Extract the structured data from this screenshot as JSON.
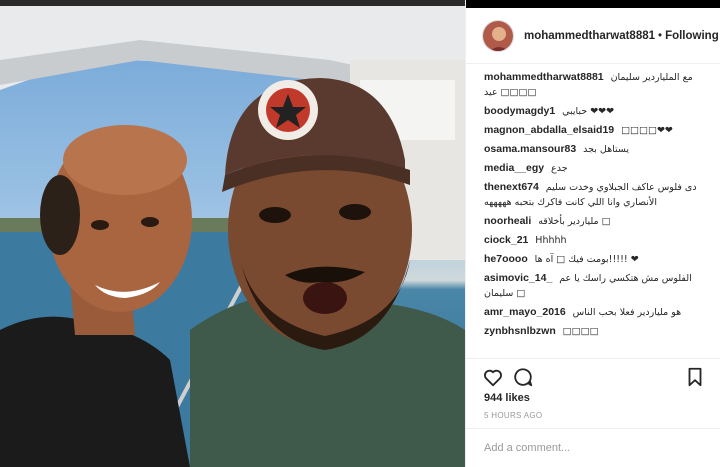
{
  "post": {
    "username": "mohammedtharwat8881",
    "separator": "•",
    "follow_state": "Following",
    "likes": "944 likes",
    "time": "5 HOURS AGO",
    "add_comment_placeholder": "Add a comment..."
  },
  "comments": [
    {
      "user": "mohammedtharwat8881",
      "text": "مع الملياردير سليمان عيد □□□□"
    },
    {
      "user": "boodymagdy1",
      "text": "حبايبي ❤❤❤"
    },
    {
      "user": "magnon_abdalla_elsaid19",
      "text": "□□□□❤❤"
    },
    {
      "user": "osama.mansour83",
      "text": "يستاهل بجد"
    },
    {
      "user": "media__egy",
      "text": "جدع"
    },
    {
      "user": "thenext674",
      "text": "دى فلوس عاكف الجبلاوي وخدت سليم الأنصاري وانا اللي كانت فاكرك بتحبه هههههه"
    },
    {
      "user": "noorheali",
      "text": "ملياردير بأخلاقه □"
    },
    {
      "user": "ciock_21",
      "text": "Hhhhh"
    },
    {
      "user": "he7oooo",
      "text": "بومت فيك □ آه ها!!!!! ❤"
    },
    {
      "user": "asimovic_14_",
      "text": "الفلوس مش هتكسي راسك يا عم سليمان □"
    },
    {
      "user": "amr_mayo_2016",
      "text": "هو ملياردير فعلا بحب الناس"
    },
    {
      "user": "zynbhsnlbzwn",
      "text": "□□□□"
    }
  ],
  "icons": {
    "like": "heart-icon",
    "comment": "comment-bubble-icon",
    "save": "bookmark-icon"
  }
}
